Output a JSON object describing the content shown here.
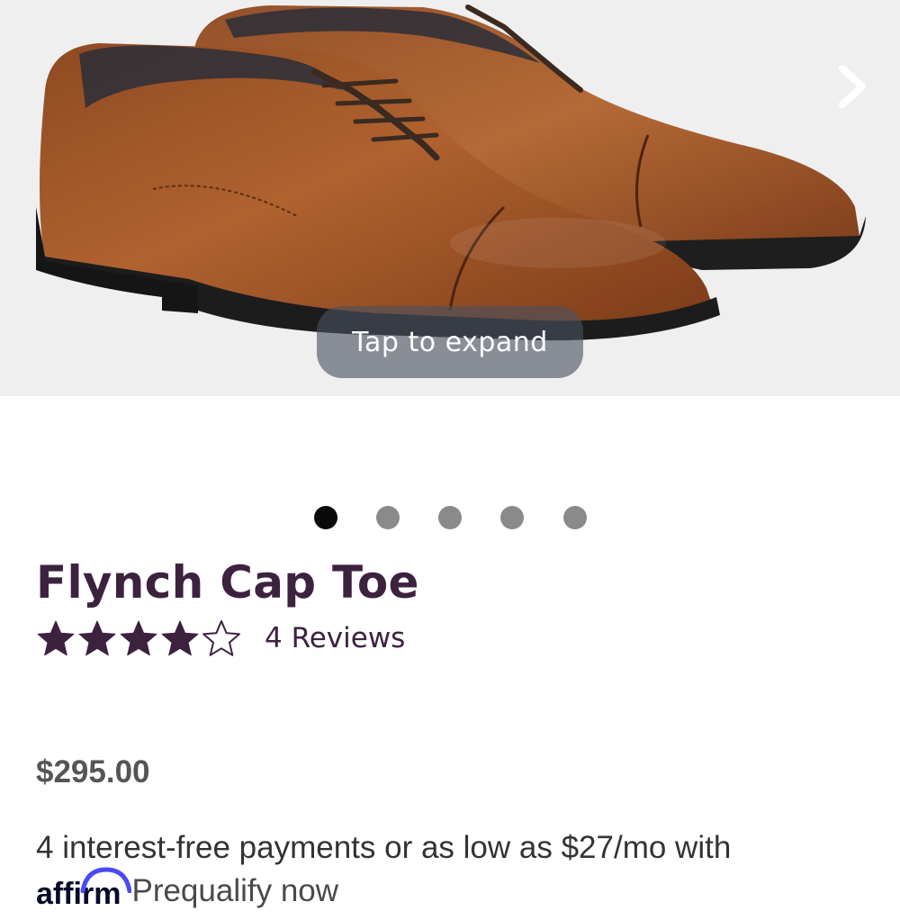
{
  "hero": {
    "expand_label": "Tap to expand",
    "next_icon": "chevron-right-icon",
    "image_subject": "shoe-pair"
  },
  "carousel": {
    "total_slides": 5,
    "active_index": 0
  },
  "product": {
    "name": "Flynch Cap Toe",
    "rating": 4,
    "rating_max": 5,
    "reviews_label": "4 Reviews",
    "price": "$295.00",
    "payments_text": "4 interest-free payments or as low as $27/mo with",
    "affirm_logo": "affirm",
    "prequalify_label": "Prequalify now"
  },
  "colors": {
    "title": "#3d2240",
    "star": "#3d2240",
    "dot_active": "#0a0a0a",
    "dot_inactive": "#8a8a8a",
    "affirm_arc": "#4a4af4"
  }
}
